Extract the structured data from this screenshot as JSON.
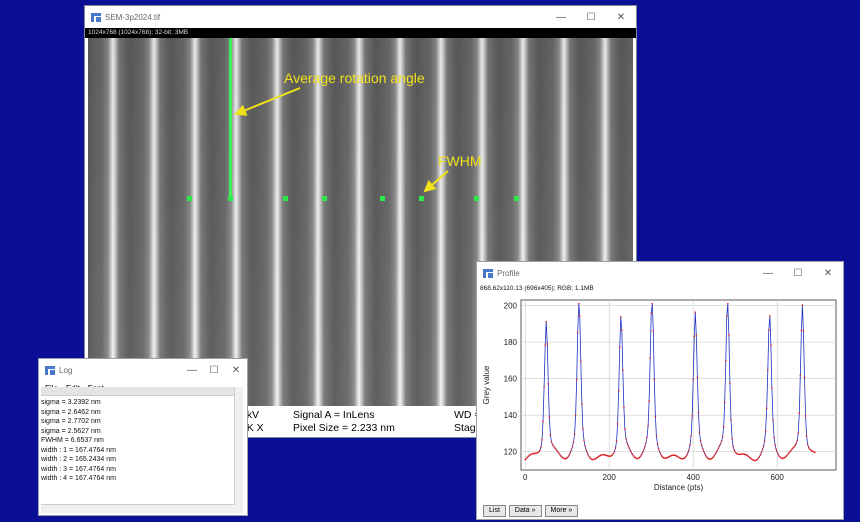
{
  "image_window": {
    "title": "SEM-3p2024.tif",
    "info": "1024x768  (1024x768); 32-bit; 3MB",
    "annotations": {
      "rotation": "Average rotation angle",
      "fwhm": "FWHM"
    },
    "sem_info": {
      "eht": "0 kV",
      "mag": "0 K X",
      "signal": "Signal A = InLens",
      "pixel": "Pixel Size = 2.233 nm",
      "wd": "WD =",
      "stage": "Stag"
    }
  },
  "log_window": {
    "title": "Log",
    "menu": [
      "File",
      "Edit",
      "Font"
    ],
    "lines": [
      "sigma =  3.2392  nm",
      "sigma =  2.6462  nm",
      "sigma =  2.7702  nm",
      "sigma =  2.5627  nm",
      "FWHM =  6.6537  nm",
      "width :  1  =  167.4764  nm",
      "width :  2  =  165.2434  nm",
      "width :  3  =  167.4764  nm",
      "width :  4  =  167.4764  nm"
    ]
  },
  "profile_window": {
    "title": "Profile",
    "info": "868.62x110.13  (696x405); RGB; 1.1MB",
    "buttons": [
      "List",
      "Data »",
      "More »"
    ]
  },
  "window_controls": {
    "minimize": "—",
    "maximize": "☐",
    "close": "✕"
  },
  "chart_data": {
    "type": "line",
    "xlabel": "Distance (pts)",
    "ylabel": "Grey value",
    "xlim": [
      -10,
      740
    ],
    "ylim": [
      110,
      203
    ],
    "xticks": [
      0,
      200,
      400,
      600
    ],
    "yticks": [
      120,
      140,
      160,
      180,
      200
    ],
    "grid": true,
    "baseline": 115,
    "peaks": [
      {
        "x": 50,
        "y": 188
      },
      {
        "x": 128,
        "y": 197
      },
      {
        "x": 228,
        "y": 190
      },
      {
        "x": 302,
        "y": 199
      },
      {
        "x": 405,
        "y": 190
      },
      {
        "x": 482,
        "y": 199
      },
      {
        "x": 582,
        "y": 189
      },
      {
        "x": 660,
        "y": 197
      }
    ],
    "colors": {
      "line": "#2030c0",
      "points": "#e02020"
    }
  }
}
